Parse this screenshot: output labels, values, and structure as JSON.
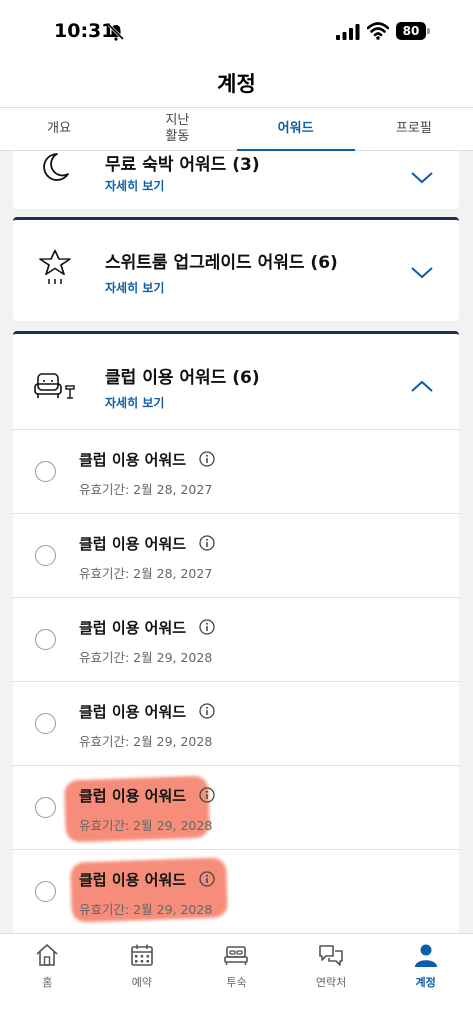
{
  "status_bar": {
    "time": "10:31",
    "battery": "80"
  },
  "header": {
    "title": "계정"
  },
  "tabs": [
    {
      "label": "개요",
      "active": false
    },
    {
      "label": "지난\n활동",
      "active": false
    },
    {
      "label": "어워드",
      "active": true
    },
    {
      "label": "프로필",
      "active": false
    }
  ],
  "cards": {
    "night": {
      "title": "무료 숙박 어워드 (3)",
      "link": "자세히 보기",
      "icon": "moon-icon"
    },
    "suite": {
      "title": "스위트룸 업그레이드 어워드 (6)",
      "link": "자세히 보기",
      "icon": "star-icon"
    },
    "club": {
      "title": "클럽 이용 어워드 (6)",
      "link": "자세히 보기",
      "icon": "lounge-chair-icon"
    }
  },
  "club_rewards": [
    {
      "name": "클럽 이용 어워드",
      "expiry": "유효기간: 2월 28, 2027"
    },
    {
      "name": "클럽 이용 어워드",
      "expiry": "유효기간: 2월 28, 2027"
    },
    {
      "name": "클럽 이용 어워드",
      "expiry": "유효기간: 2월 29, 2028"
    },
    {
      "name": "클럽 이용 어워드",
      "expiry": "유효기간: 2월 29, 2028"
    },
    {
      "name": "클럽 이용 어워드",
      "expiry": "유효기간: 2월 29, 2028"
    },
    {
      "name": "클럽 이용 어워드",
      "expiry": "유효기간: 2월 29, 2028"
    }
  ],
  "bottom_nav": [
    {
      "label": "홈",
      "icon": "home-icon",
      "active": false
    },
    {
      "label": "예약",
      "icon": "calendar-icon",
      "active": false
    },
    {
      "label": "투숙",
      "icon": "bed-icon",
      "active": false
    },
    {
      "label": "연락처",
      "icon": "chat-icon",
      "active": false
    },
    {
      "label": "계정",
      "icon": "person-icon",
      "active": true
    }
  ],
  "colors": {
    "accent": "#0b5ea8",
    "card_border": "#1d2e5c",
    "highlight": "#f05032"
  }
}
